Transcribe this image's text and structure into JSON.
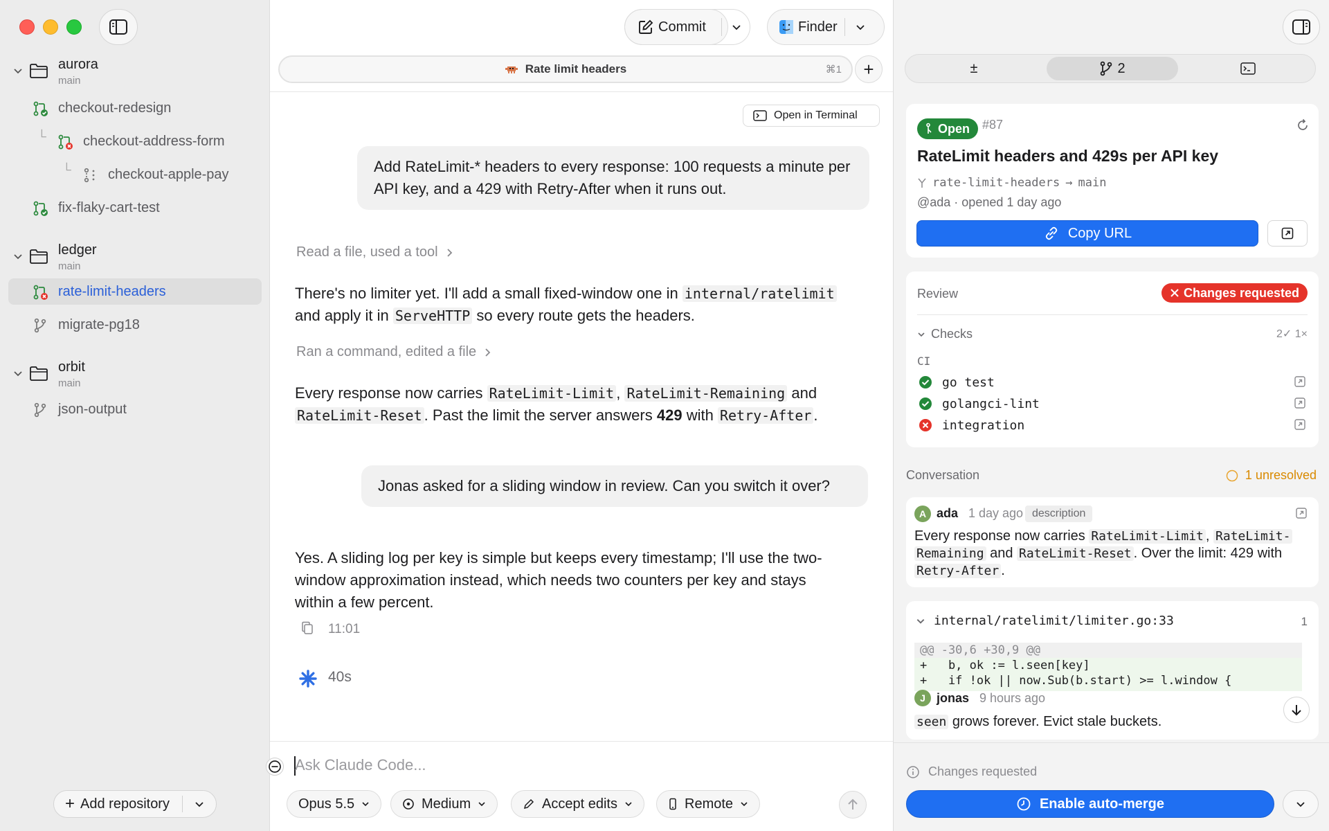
{
  "sidebar": {
    "repos": [
      {
        "name": "aurora",
        "branch": "main"
      },
      {
        "name": "ledger",
        "branch": "main"
      },
      {
        "name": "orbit",
        "branch": "main"
      }
    ],
    "worktrees": [
      {
        "label": "checkout-redesign"
      },
      {
        "label": "checkout-address-form"
      },
      {
        "label": "checkout-apple-pay"
      },
      {
        "label": "fix-flaky-cart-test"
      },
      {
        "label": "rate-limit-headers"
      },
      {
        "label": "migrate-pg18"
      },
      {
        "label": "json-output"
      }
    ],
    "add_repo_label": "Add repository"
  },
  "toolbar": {
    "commit_label": "Commit",
    "finder_label": "Finder"
  },
  "tab": {
    "title": "Rate limit headers",
    "shortcut": "⌘1"
  },
  "open_terminal_label": "Open in Terminal",
  "conversation": {
    "user1": "Add RateLimit-* headers to every response: 100 requests a minute per API key, and a 429 with Retry-After when it runs out.",
    "tool1": "Read a file, used a tool",
    "assistant1": {
      "p1": "There's no limiter yet. I'll add a small fixed-window one in",
      "c1": "internal/ratelimit",
      "p2": "and apply it in",
      "c2": "ServeHTTP",
      "p3": "so every route gets the headers."
    },
    "tool2": "Ran a command, edited a file",
    "assistant2": {
      "p1": "Every response now carries",
      "c1": "RateLimit-Limit",
      "c2": "RateLimit-Remaining",
      "p2": "and",
      "c3": "RateLimit-Reset",
      "p3": ". Past the limit the server answers",
      "b1": "429",
      "p4": "with",
      "c4": "Retry-After",
      "p5": "."
    },
    "user2": "Jonas asked for a sliding window in review. Can you switch it over?",
    "assistant3": "Yes. A sliding log per key is simple but keeps every timestamp; I'll use the two-window approximation instead, which needs two counters per key and stays within a few percent.",
    "timestamp": "11:01",
    "working_time": "40s"
  },
  "composer": {
    "placeholder": "Ask Claude Code...",
    "model": "Opus 5.5",
    "effort": "Medium",
    "mode": "Accept edits",
    "env": "Remote"
  },
  "right": {
    "tabs": {
      "diff_symbol": "±",
      "branch_count": "2"
    },
    "pr": {
      "status": "Open",
      "number": "#87",
      "title": "RateLimit headers and 429s per API key",
      "head_branch": "rate-limit-headers",
      "base_branch": "main",
      "meta": "@ada · opened 1 day ago",
      "copy_url_label": "Copy URL"
    },
    "review": {
      "label": "Review",
      "badge": "Changes requested",
      "checks_label": "Checks",
      "counts": "2✓ 1×",
      "group": "CI",
      "items": [
        {
          "name": "go test",
          "status": "pass"
        },
        {
          "name": "golangci-lint",
          "status": "pass"
        },
        {
          "name": "integration",
          "status": "fail"
        }
      ]
    },
    "conversation": {
      "label": "Conversation",
      "unresolved": "1 unresolved",
      "comment1": {
        "avatar": "A",
        "author": "ada",
        "time": "1 day ago",
        "tag": "description",
        "t1": "Every response now carries",
        "c1": "RateLimit-Limit",
        "c2a": "RateLimit-",
        "c2b": "Remaining",
        "t2": "and",
        "c3": "RateLimit-Reset",
        "t3": ". Over the limit: 429 with",
        "c4": "Retry-After",
        "t4": "."
      },
      "thread": {
        "file": "internal/ratelimit/limiter.go:33",
        "count": "1",
        "diff": [
          "@@ -30,6 +30,9 @@",
          "+   b, ok := l.seen[key]",
          "+   if !ok || now.Sub(b.start) >= l.window {"
        ],
        "avatar": "J",
        "author": "jonas",
        "time": "9 hours ago",
        "c1": "seen",
        "t1": "grows forever. Evict stale buckets."
      }
    },
    "footer": {
      "status": "Changes requested",
      "automerge_label": "Enable auto-merge"
    }
  }
}
